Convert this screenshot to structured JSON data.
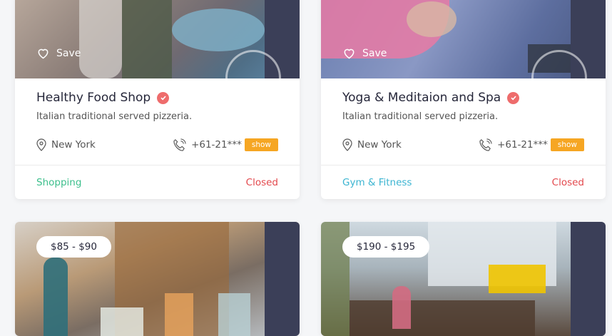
{
  "cards": [
    {
      "save_label": "Save",
      "title": "Healthy Food Shop",
      "description": "Italian traditional served pizzeria.",
      "location": "New York",
      "phone": "+61-21***",
      "show_label": "show",
      "category": "Shopping",
      "category_color": "#3cbf8c",
      "status": "Closed"
    },
    {
      "save_label": "Save",
      "title": "Yoga & Meditaion and Spa",
      "description": "Italian traditional served pizzeria.",
      "location": "New York",
      "phone": "+61-21***",
      "show_label": "show",
      "category": "Gym & Fitness",
      "category_color": "#3bb4d1",
      "status": "Closed"
    },
    {
      "price": "$85 - $90"
    },
    {
      "price": "$190 - $195"
    }
  ]
}
